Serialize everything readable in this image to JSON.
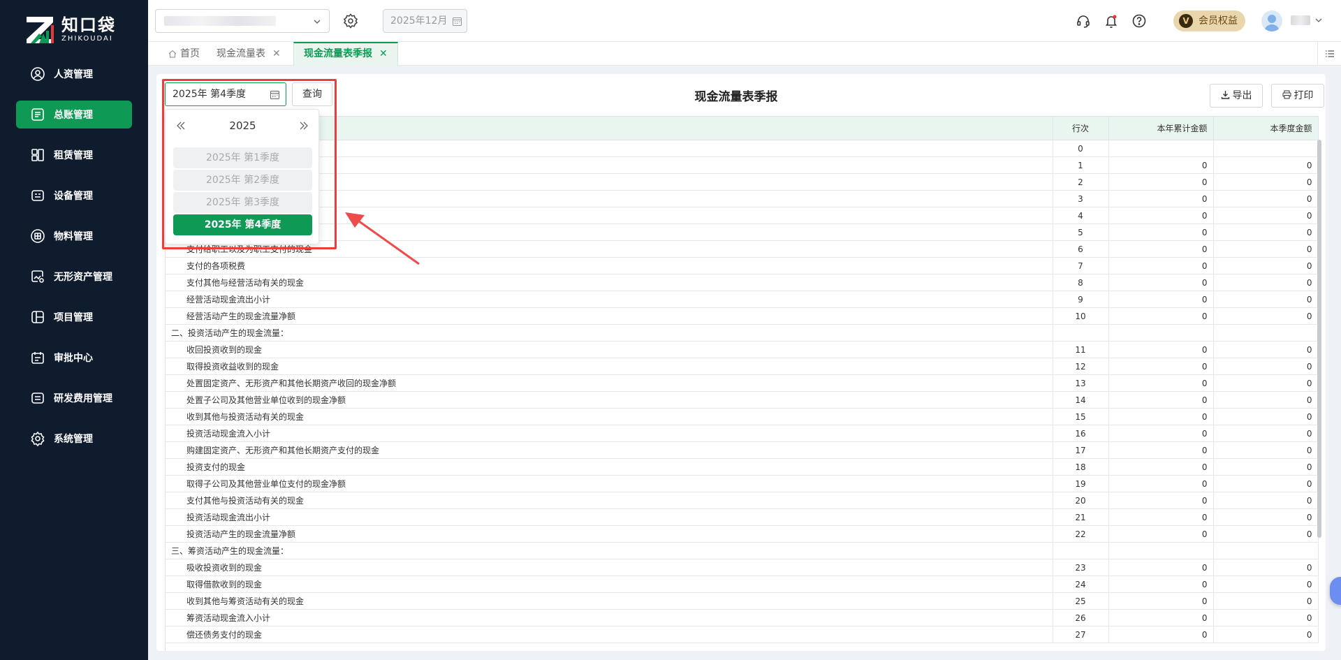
{
  "brand": {
    "name_cn": "知口袋",
    "name_en": "ZHIKOUDAI"
  },
  "sidebar": {
    "items": [
      {
        "label": "人资管理",
        "icon": "user-circle-icon",
        "active": false
      },
      {
        "label": "总账管理",
        "icon": "ledger-icon",
        "active": true
      },
      {
        "label": "租赁管理",
        "icon": "lease-icon",
        "active": false
      },
      {
        "label": "设备管理",
        "icon": "device-icon",
        "active": false
      },
      {
        "label": "物料管理",
        "icon": "material-icon",
        "active": false
      },
      {
        "label": "无形资产管理",
        "icon": "intangible-asset-icon",
        "active": false
      },
      {
        "label": "项目管理",
        "icon": "project-icon",
        "active": false
      },
      {
        "label": "审批中心",
        "icon": "approval-icon",
        "active": false
      },
      {
        "label": "研发费用管理",
        "icon": "rd-expense-icon",
        "active": false
      },
      {
        "label": "系统管理",
        "icon": "gear-icon",
        "active": false
      }
    ]
  },
  "header": {
    "period": "2025年12月",
    "member_label": "会员权益",
    "member_badge": "V"
  },
  "tabs": [
    {
      "label": "首页",
      "closable": false,
      "active": false
    },
    {
      "label": "现金流量表",
      "closable": true,
      "active": false
    },
    {
      "label": "现金流量表季报",
      "closable": true,
      "active": true
    }
  ],
  "toolbar": {
    "quarter_value": "2025年 第4季度",
    "query_label": "查询",
    "export_label": "导出",
    "print_label": "打印"
  },
  "report": {
    "title": "现金流量表季报"
  },
  "quarter_picker": {
    "year": "2025",
    "options": [
      {
        "label": "2025年 第1季度",
        "selected": false
      },
      {
        "label": "2025年 第2季度",
        "selected": false
      },
      {
        "label": "2025年 第3季度",
        "selected": false
      },
      {
        "label": "2025年 第4季度",
        "selected": true
      }
    ]
  },
  "table": {
    "columns": [
      "",
      "行次",
      "本年累计金额",
      "本季度金额"
    ],
    "rows": [
      {
        "item": "",
        "no": "0",
        "ytd": "",
        "qtr": "",
        "section": false
      },
      {
        "item": "",
        "no": "1",
        "ytd": "0",
        "qtr": "0",
        "section": false
      },
      {
        "item": "",
        "no": "2",
        "ytd": "0",
        "qtr": "0",
        "section": false
      },
      {
        "item": "",
        "no": "3",
        "ytd": "0",
        "qtr": "0",
        "section": false
      },
      {
        "item": "",
        "no": "4",
        "ytd": "0",
        "qtr": "0",
        "section": false
      },
      {
        "item": "",
        "no": "5",
        "ytd": "0",
        "qtr": "0",
        "section": false
      },
      {
        "item": "支付给职工以及为职工支付的现金",
        "no": "6",
        "ytd": "0",
        "qtr": "0",
        "section": false
      },
      {
        "item": "支付的各项税费",
        "no": "7",
        "ytd": "0",
        "qtr": "0",
        "section": false
      },
      {
        "item": "支付其他与经营活动有关的现金",
        "no": "8",
        "ytd": "0",
        "qtr": "0",
        "section": false
      },
      {
        "item": "经营活动现金流出小计",
        "no": "9",
        "ytd": "0",
        "qtr": "0",
        "section": false
      },
      {
        "item": "经营活动产生的现金流量净额",
        "no": "10",
        "ytd": "0",
        "qtr": "0",
        "section": false
      },
      {
        "item": "二、投资活动产生的现金流量：",
        "no": "",
        "ytd": "",
        "qtr": "",
        "section": true
      },
      {
        "item": "收回投资收到的现金",
        "no": "11",
        "ytd": "0",
        "qtr": "0",
        "section": false
      },
      {
        "item": "取得投资收益收到的现金",
        "no": "12",
        "ytd": "0",
        "qtr": "0",
        "section": false
      },
      {
        "item": "处置固定资产、无形资产和其他长期资产收回的现金净额",
        "no": "13",
        "ytd": "0",
        "qtr": "0",
        "section": false
      },
      {
        "item": "处置子公司及其他营业单位收到的现金净额",
        "no": "14",
        "ytd": "0",
        "qtr": "0",
        "section": false
      },
      {
        "item": "收到其他与投资活动有关的现金",
        "no": "15",
        "ytd": "0",
        "qtr": "0",
        "section": false
      },
      {
        "item": "投资活动现金流入小计",
        "no": "16",
        "ytd": "0",
        "qtr": "0",
        "section": false
      },
      {
        "item": "购建固定资产、无形资产和其他长期资产支付的现金",
        "no": "17",
        "ytd": "0",
        "qtr": "0",
        "section": false
      },
      {
        "item": "投资支付的现金",
        "no": "18",
        "ytd": "0",
        "qtr": "0",
        "section": false
      },
      {
        "item": "取得子公司及其他营业单位支付的现金净额",
        "no": "19",
        "ytd": "0",
        "qtr": "0",
        "section": false
      },
      {
        "item": "支付其他与投资活动有关的现金",
        "no": "20",
        "ytd": "0",
        "qtr": "0",
        "section": false
      },
      {
        "item": "投资活动现金流出小计",
        "no": "21",
        "ytd": "0",
        "qtr": "0",
        "section": false
      },
      {
        "item": "投资活动产生的现金流量净额",
        "no": "22",
        "ytd": "0",
        "qtr": "0",
        "section": false
      },
      {
        "item": "三、筹资活动产生的现金流量：",
        "no": "",
        "ytd": "",
        "qtr": "",
        "section": true
      },
      {
        "item": "吸收投资收到的现金",
        "no": "23",
        "ytd": "0",
        "qtr": "0",
        "section": false
      },
      {
        "item": "取得借款收到的现金",
        "no": "24",
        "ytd": "0",
        "qtr": "0",
        "section": false
      },
      {
        "item": "收到其他与筹资活动有关的现金",
        "no": "25",
        "ytd": "0",
        "qtr": "0",
        "section": false
      },
      {
        "item": "筹资活动现金流入小计",
        "no": "26",
        "ytd": "0",
        "qtr": "0",
        "section": false
      },
      {
        "item": "偿还债务支付的现金",
        "no": "27",
        "ytd": "0",
        "qtr": "0",
        "section": false
      }
    ]
  },
  "colors": {
    "brand_green": "#0e9a55",
    "sidebar_bg": "#0f1c2e",
    "highlight_red": "#ee3b3b",
    "header_row": "#e9f5ef"
  }
}
